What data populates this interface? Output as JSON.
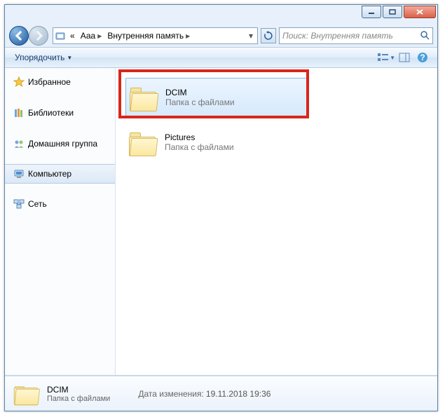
{
  "breadcrumb": {
    "seg1": "Ааа",
    "seg2": "Внутренняя память",
    "prefix": "«"
  },
  "search": {
    "placeholder": "Поиск: Внутренняя память"
  },
  "toolbar": {
    "organize": "Упорядочить"
  },
  "tree": {
    "favorites": "Избранное",
    "libraries": "Библиотеки",
    "homegroup": "Домашняя группа",
    "computer": "Компьютер",
    "network": "Сеть"
  },
  "folders": [
    {
      "name": "DCIM",
      "desc": "Папка с файлами"
    },
    {
      "name": "Pictures",
      "desc": "Папка с файлами"
    }
  ],
  "details": {
    "name": "DCIM",
    "desc": "Папка с файлами",
    "date_label": "Дата изменения:",
    "date_value": "19.11.2018 19:36"
  }
}
